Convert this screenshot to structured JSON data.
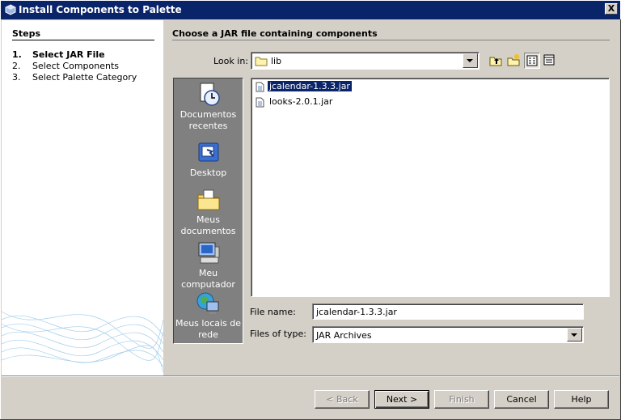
{
  "window": {
    "title": "Install Components to Palette",
    "close_label": "X"
  },
  "steps": {
    "heading": "Steps",
    "items": [
      {
        "num": "1.",
        "label": "Select JAR File"
      },
      {
        "num": "2.",
        "label": "Select Components"
      },
      {
        "num": "3.",
        "label": "Select Palette Category"
      }
    ],
    "current_index": 0
  },
  "main": {
    "heading": "Choose a JAR file containing components"
  },
  "look_in": {
    "label": "Look in:",
    "value": "lib"
  },
  "toolbar": {
    "icons": [
      "up-folder-icon",
      "new-folder-icon",
      "list-view-icon",
      "details-view-icon"
    ]
  },
  "places": [
    {
      "label": "Documentos recentes",
      "icon": "recent-documents-icon"
    },
    {
      "label": "Desktop",
      "icon": "desktop-icon"
    },
    {
      "label": "Meus documentos",
      "icon": "my-documents-icon"
    },
    {
      "label": "Meu computador",
      "icon": "my-computer-icon"
    },
    {
      "label": "Meus locais de rede",
      "icon": "network-places-icon"
    }
  ],
  "files": [
    {
      "name": "jcalendar-1.3.3.jar",
      "selected": true
    },
    {
      "name": "looks-2.0.1.jar",
      "selected": false
    }
  ],
  "file_name": {
    "label": "File name:",
    "value": "jcalendar-1.3.3.jar"
  },
  "files_of_type": {
    "label": "Files of type:",
    "value": "JAR Archives"
  },
  "buttons": {
    "back": "< Back",
    "next": "Next >",
    "finish": "Finish",
    "cancel": "Cancel",
    "help": "Help"
  },
  "colors": {
    "title_bar": "#0a246a",
    "selection": "#0a246a",
    "dialog_bg": "#d4d0c8",
    "places_bg": "#808080"
  }
}
